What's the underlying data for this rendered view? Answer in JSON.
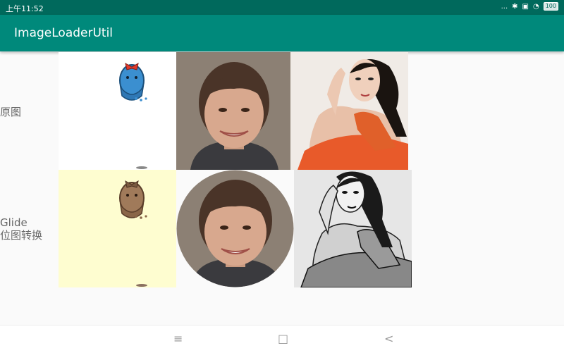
{
  "status_bar": {
    "time": "上午11:52",
    "signal": "...",
    "battery": "100"
  },
  "app_bar": {
    "title": "ImageLoaderUtil"
  },
  "rows": [
    {
      "label": "原图"
    },
    {
      "label_line1": "Glide",
      "label_line2": "位图转换"
    }
  ],
  "nav": {
    "menu": "≡",
    "home": "□",
    "back": "<"
  }
}
